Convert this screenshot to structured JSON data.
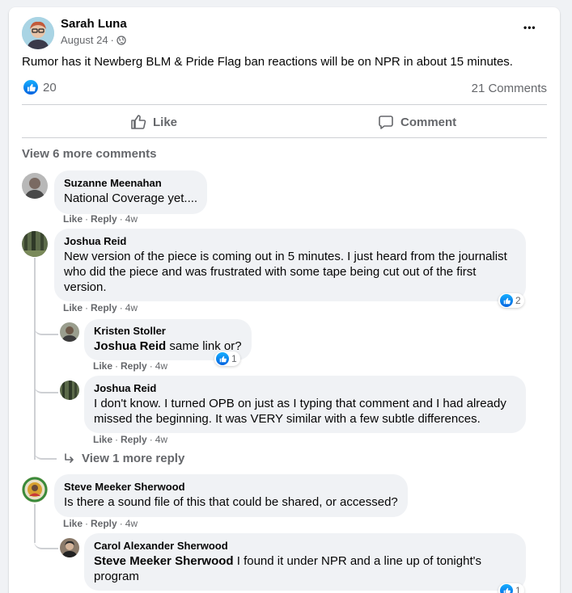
{
  "post": {
    "author": "Sarah Luna",
    "date": "August 24",
    "privacy_icon": "public-globe-icon",
    "text": "Rumor has it Newberg BLM & Pride Flag ban reactions will be on NPR in about 15 minutes.",
    "like_count": "20",
    "comments_count": "21 Comments",
    "more_icon": "•••"
  },
  "actions": {
    "like_label": "Like",
    "comment_label": "Comment"
  },
  "view_more_comments": "View 6 more comments",
  "labels": {
    "like": "Like",
    "reply": "Reply",
    "dot": "·"
  },
  "comments": [
    {
      "name": "Suzanne Meenahan",
      "text": "National Coverage yet....",
      "time": "4w"
    },
    {
      "name": "Joshua Reid",
      "text": "New version of the piece is coming out in 5 minutes. I just heard from the journalist who did the piece and was frustrated with some tape being cut out of the first version.",
      "time": "4w",
      "reactions": "2",
      "replies": [
        {
          "name": "Kristen Stoller",
          "mention": "Joshua Reid",
          "text": " same link or?",
          "time": "4w",
          "reactions": "1"
        },
        {
          "name": "Joshua Reid",
          "text": "I don't know. I turned OPB on just as I typing that comment and I had already missed the beginning. It was VERY similar with a few subtle differences.",
          "time": "4w"
        }
      ],
      "view_more_reply": "View 1 more reply"
    },
    {
      "name": "Steve Meeker Sherwood",
      "text": "Is there a sound file of this that could be shared, or accessed?",
      "time": "4w",
      "replies": [
        {
          "name": "Carol Alexander Sherwood",
          "mention": "Steve Meeker Sherwood",
          "text": " I found it under NPR and a line up of tonight's program",
          "reactions": "1"
        }
      ]
    }
  ],
  "colors": {
    "like_blue": "#1877f2",
    "secondary_text": "#65676b",
    "bubble": "#f0f2f5",
    "divider": "#ced0d4"
  }
}
